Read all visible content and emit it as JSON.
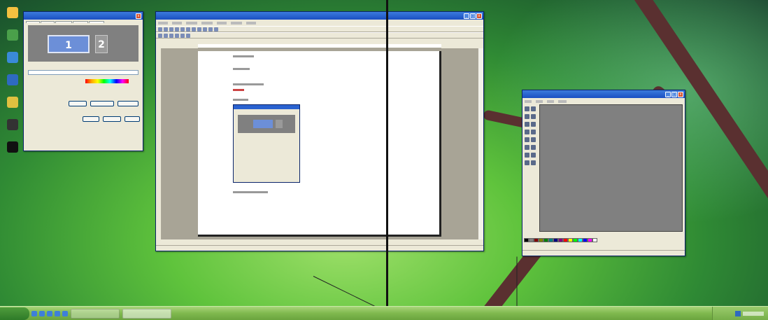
{
  "colors": {
    "titlebar": "#1b4fc2",
    "taskbar": "#7fb84e",
    "canvas": "#808080",
    "divider": "#111111"
  },
  "display_dialog": {
    "monitor_1": "1",
    "monitor_2": "2"
  },
  "desktop_icons": [
    "my-computer-icon",
    "my-documents-icon",
    "network-icon",
    "recycle-bin-icon",
    "internet-icon",
    "media-icon",
    "terminal-icon"
  ],
  "word_window": {},
  "paint_window": {},
  "taskbar": {}
}
